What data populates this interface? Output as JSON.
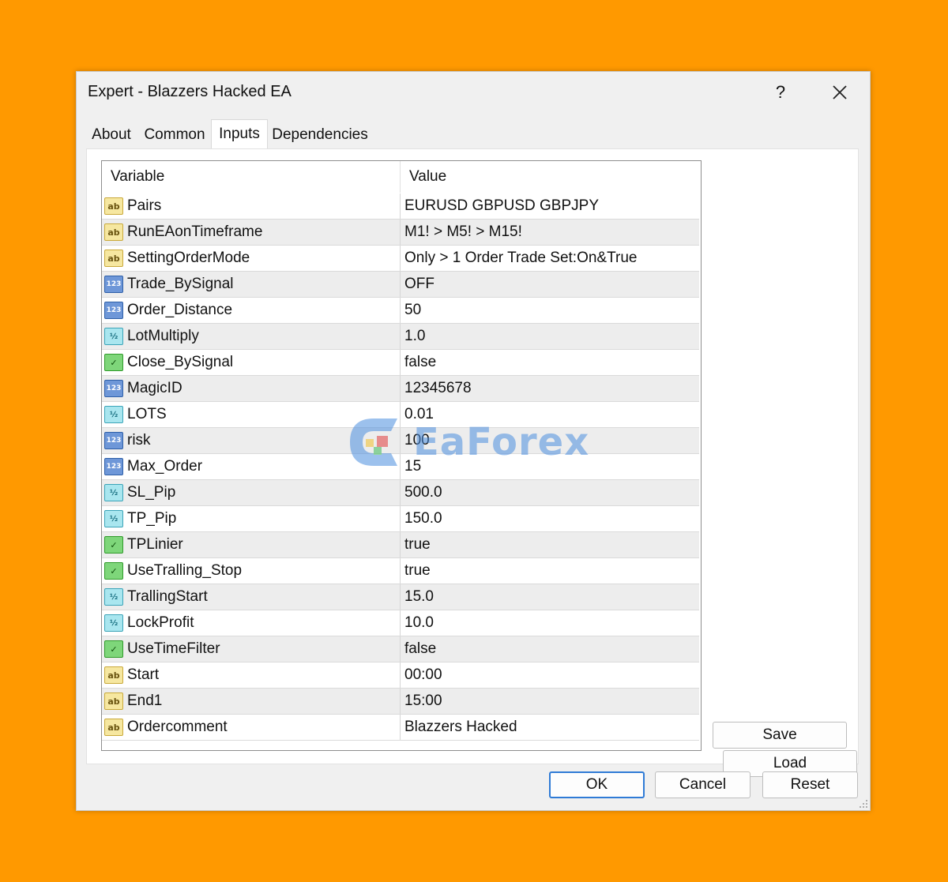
{
  "window": {
    "title": "Expert - Blazzers Hacked EA",
    "help_label": "?",
    "close_label": "✕"
  },
  "tabs": [
    {
      "label": "About",
      "active": false
    },
    {
      "label": "Common",
      "active": false
    },
    {
      "label": "Inputs",
      "active": true
    },
    {
      "label": "Dependencies",
      "active": false
    }
  ],
  "grid": {
    "headers": {
      "variable": "Variable",
      "value": "Value"
    },
    "rows": [
      {
        "type": "string",
        "variable": "Pairs",
        "value": "EURUSD GBPUSD GBPJPY"
      },
      {
        "type": "string",
        "variable": "RunEAonTimeframe",
        "value": "M1! > M5! > M15!"
      },
      {
        "type": "string",
        "variable": "SettingOrderMode",
        "value": "Only > 1 Order Trade Set:On&True"
      },
      {
        "type": "int",
        "variable": "Trade_BySignal",
        "value": "OFF"
      },
      {
        "type": "int",
        "variable": "Order_Distance",
        "value": "50"
      },
      {
        "type": "double",
        "variable": "LotMultiply",
        "value": "1.0"
      },
      {
        "type": "bool",
        "variable": "Close_BySignal",
        "value": "false"
      },
      {
        "type": "int",
        "variable": "MagicID",
        "value": "12345678"
      },
      {
        "type": "double",
        "variable": "LOTS",
        "value": "0.01"
      },
      {
        "type": "int",
        "variable": "risk",
        "value": "100"
      },
      {
        "type": "int",
        "variable": "Max_Order",
        "value": "15"
      },
      {
        "type": "double",
        "variable": "SL_Pip",
        "value": "500.0"
      },
      {
        "type": "double",
        "variable": "TP_Pip",
        "value": "150.0"
      },
      {
        "type": "bool",
        "variable": "TPLinier",
        "value": "true"
      },
      {
        "type": "bool",
        "variable": "UseTralling_Stop",
        "value": "true"
      },
      {
        "type": "double",
        "variable": "TrallingStart",
        "value": "15.0"
      },
      {
        "type": "double",
        "variable": "LockProfit",
        "value": "10.0"
      },
      {
        "type": "bool",
        "variable": "UseTimeFilter",
        "value": "false"
      },
      {
        "type": "string",
        "variable": "Start",
        "value": "00:00"
      },
      {
        "type": "string",
        "variable": "End1",
        "value": "15:00"
      },
      {
        "type": "string",
        "variable": "Ordercomment",
        "value": "Blazzers Hacked"
      }
    ]
  },
  "icons": {
    "string": {
      "name": "string-type-icon",
      "glyph": "ab"
    },
    "int": {
      "name": "integer-type-icon",
      "glyph": "123"
    },
    "double": {
      "name": "double-type-icon",
      "glyph": "½"
    },
    "bool": {
      "name": "bool-type-icon",
      "glyph": "✓"
    }
  },
  "watermark": {
    "text": "EaForex"
  },
  "side_buttons": {
    "load": "Load",
    "save": "Save"
  },
  "footer_buttons": {
    "ok": "OK",
    "cancel": "Cancel",
    "reset": "Reset"
  },
  "colors": {
    "background": "#FF9900",
    "ok_border": "#2F7BD6",
    "watermark": "#4D8FE0"
  }
}
